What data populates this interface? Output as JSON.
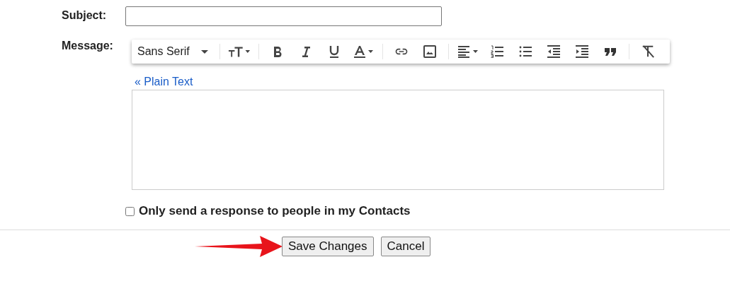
{
  "subject": {
    "label": "Subject:"
  },
  "message": {
    "label": "Message:",
    "font": "Sans Serif",
    "toolbar_groups": [
      [
        {
          "kind": "size"
        }
      ],
      [
        {
          "kind": "bold"
        },
        {
          "kind": "italic"
        },
        {
          "kind": "underline"
        },
        {
          "kind": "color"
        }
      ],
      [
        {
          "kind": "link"
        },
        {
          "kind": "image"
        }
      ],
      [
        {
          "kind": "align"
        },
        {
          "kind": "numbered"
        },
        {
          "kind": "bulleted"
        },
        {
          "kind": "outdent"
        },
        {
          "kind": "indent"
        },
        {
          "kind": "quote"
        }
      ],
      [
        {
          "kind": "clear"
        }
      ]
    ],
    "plain_text_link": "« Plain Text"
  },
  "contacts_only": {
    "label": "Only send a response to people in my Contacts",
    "checked": false
  },
  "buttons": [
    {
      "label": "Save Changes"
    },
    {
      "label": "Cancel"
    }
  ]
}
